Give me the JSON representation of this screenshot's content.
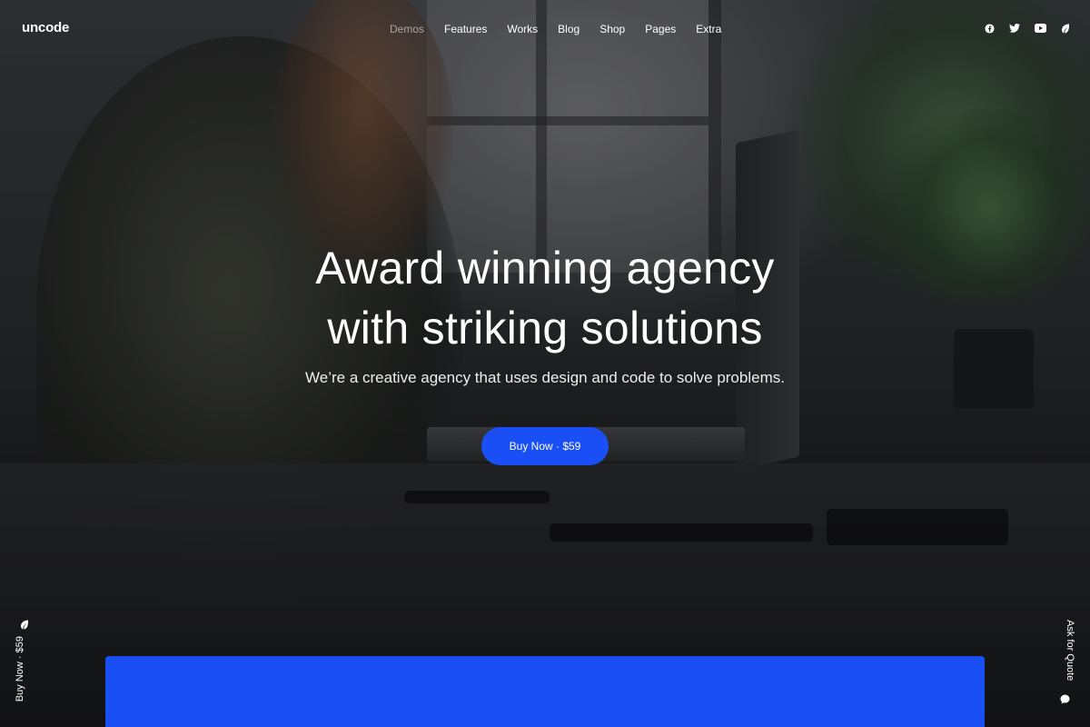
{
  "brand": {
    "logo_text": "uncode"
  },
  "nav": {
    "items": [
      {
        "label": "Demos",
        "state": "muted"
      },
      {
        "label": "Features"
      },
      {
        "label": "Works"
      },
      {
        "label": "Blog"
      },
      {
        "label": "Shop"
      },
      {
        "label": "Pages"
      },
      {
        "label": "Extra"
      }
    ]
  },
  "social": {
    "icons": [
      "facebook-icon",
      "twitter-icon",
      "youtube-icon",
      "leaf-icon"
    ]
  },
  "hero": {
    "title_line1": "Award winning agency",
    "title_line2": "with striking solutions",
    "subtitle": "We’re a creative agency that uses design and code to solve problems.",
    "cta_label": "Buy Now · $59"
  },
  "side": {
    "left_label": "Buy Now · $59",
    "right_label": "Ask for Quote"
  },
  "colors": {
    "accent": "#1a4ff5",
    "text": "#ffffff",
    "background": "#15171a"
  }
}
